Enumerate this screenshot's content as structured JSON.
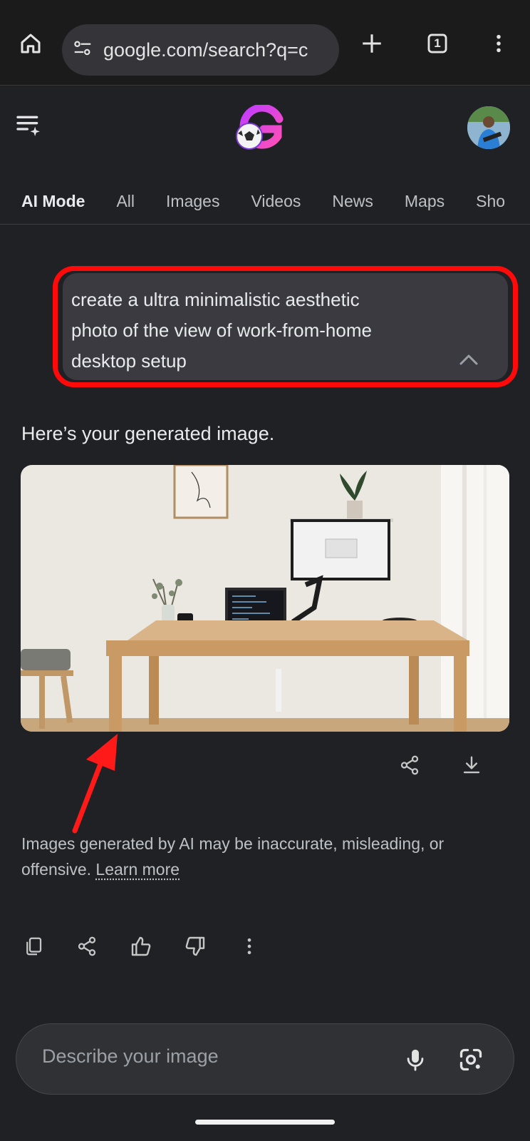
{
  "browser": {
    "url": "google.com/search?q=c",
    "tab_count": "1"
  },
  "header": {
    "logo_icon": "google-doodle-soccer-icon",
    "avatar": "profile-avatar"
  },
  "tabs": [
    {
      "label": "AI Mode",
      "active": true
    },
    {
      "label": "All"
    },
    {
      "label": "Images"
    },
    {
      "label": "Videos"
    },
    {
      "label": "News"
    },
    {
      "label": "Maps"
    },
    {
      "label": "Sho"
    }
  ],
  "prompt": {
    "line1": "create a ultra minimalistic aesthetic",
    "line2": "photo of the view of work-from-home",
    "line3": "desktop setup"
  },
  "reply_text": "Here’s your generated image.",
  "disclaimer": {
    "text": "Images generated by AI may be inaccurate, misleading, or offensive.",
    "link": "Learn more"
  },
  "input": {
    "placeholder": "Describe your image"
  },
  "colors": {
    "background": "#202124",
    "highlight_red": "#ff0a0a",
    "prompt_bg": "#3a3a40"
  }
}
